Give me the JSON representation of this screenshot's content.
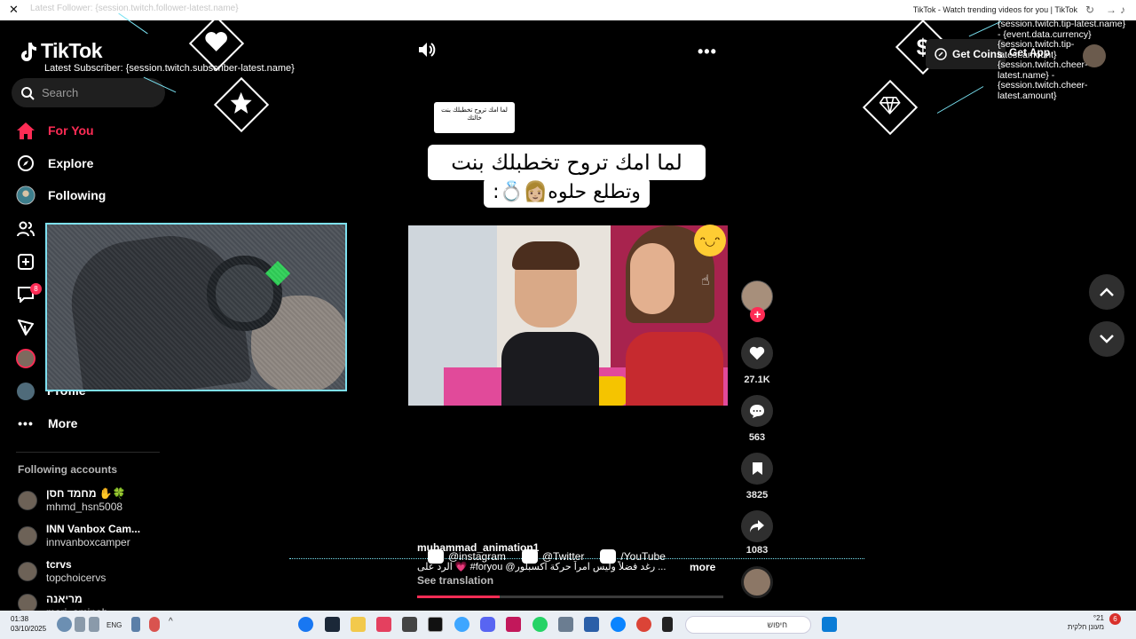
{
  "window": {
    "title": "TikTok - Watch trending videos for you | TikTok",
    "ghost_text": "Latest Follower: {session.twitch.follower-latest.name}"
  },
  "brand": {
    "logo": "TikTok"
  },
  "overlays": {
    "latest_subscriber": "Latest Subscriber: {session.twitch.subscriber-latest.name}",
    "tip_text": "{session.twitch.tip-latest.name} - {event.data.currency} {session.twitch.tip-latest.amount}",
    "cheer_text": "{session.twitch.cheer-latest.name} - {session.twitch.cheer-latest.amount}"
  },
  "search": {
    "placeholder": "Search"
  },
  "nav": {
    "for_you": "For You",
    "explore": "Explore",
    "following": "Following",
    "profile": "Profile",
    "more": "More",
    "inbox_badge": "8"
  },
  "following_accounts": {
    "title": "Following accounts",
    "items": [
      {
        "display": "מחמד חסן ✋🍀",
        "handle": "mhmd_hsn5008"
      },
      {
        "display": "INN Vanbox Cam...",
        "handle": "innvanboxcamper"
      },
      {
        "display": "tcrvs",
        "handle": "topchoicervs"
      },
      {
        "display": "מריאנה",
        "handle": "mari_aminah"
      }
    ]
  },
  "video": {
    "small_caption": "لما امك تروح تخطبلك بنت خالتك",
    "caption_line1": "لما امك تروح تخطبلك بنت خالتك",
    "caption_line2": "وتطلع حلوه👩🏼💍:",
    "author": "muhammad_animation1",
    "description": "الرد على 💗 #foryou @رغد فضلاً وليس امراً حركة اكسبلور ...",
    "more": "more",
    "see_translation": "See translation",
    "progress": 0.27
  },
  "socials": [
    {
      "label": "@instagram"
    },
    {
      "label": "@Twitter"
    },
    {
      "label": "/YouTube"
    }
  ],
  "actions": {
    "likes": "27.1K",
    "comments": "563",
    "saves": "3825",
    "shares": "1083"
  },
  "header_right": {
    "get_coins": "Get Coins",
    "get_app": "Get App"
  },
  "taskbar": {
    "time": "01:38",
    "date": "03/10/2025",
    "lang": "ENG",
    "search_placeholder": "חיפוש",
    "weather_temp": "°21",
    "weather_desc": "מעונן חלקית",
    "notifications": "6"
  }
}
